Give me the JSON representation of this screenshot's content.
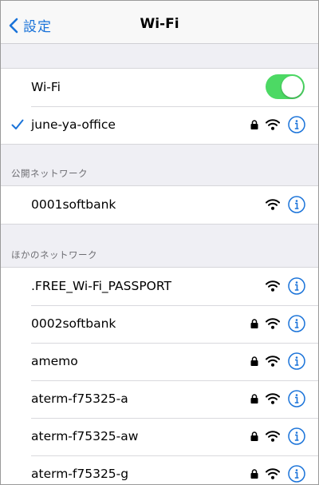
{
  "nav": {
    "back_label": "設定",
    "title": "Wi-Fi"
  },
  "wifi_toggle": {
    "label": "Wi-Fi",
    "on": true
  },
  "connected": {
    "name": "june-ya-office",
    "locked": true,
    "icon": "checkmark-icon"
  },
  "public_section": {
    "header": "公開ネットワーク",
    "networks": [
      {
        "name": "0001softbank",
        "locked": false
      }
    ]
  },
  "other_section": {
    "header": "ほかのネットワーク",
    "networks": [
      {
        "name": ".FREE_Wi-Fi_PASSPORT",
        "locked": false
      },
      {
        "name": "0002softbank",
        "locked": true
      },
      {
        "name": "amemo",
        "locked": true
      },
      {
        "name": "aterm-f75325-a",
        "locked": true
      },
      {
        "name": "aterm-f75325-aw",
        "locked": true
      },
      {
        "name": "aterm-f75325-g",
        "locked": true
      }
    ]
  },
  "colors": {
    "accent": "#1a73d9",
    "toggle_on": "#4cd964",
    "background": "#efeff4"
  }
}
